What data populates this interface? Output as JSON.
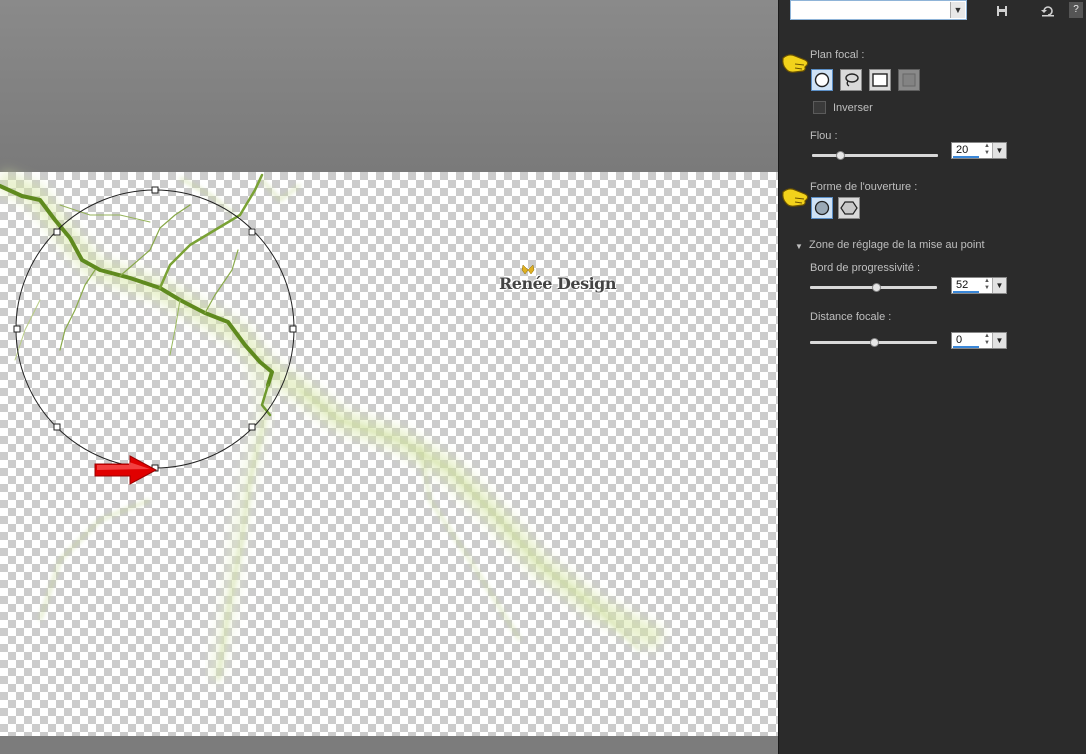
{
  "panel": {
    "preset_value": "",
    "plan_focal_label": "Plan focal :",
    "inverser_label": "Inverser",
    "flou_label": "Flou :",
    "flou_value": "20",
    "forme_label": "Forme de l'ouverture :",
    "zone_label": "Zone de réglage de la mise au point",
    "bord_label": "Bord de progressivité :",
    "bord_value": "52",
    "distance_label": "Distance focale :",
    "distance_value": "0",
    "help": "?"
  },
  "canvas": {
    "watermark": "Renée Design"
  },
  "colors": {
    "accent": "#3a87d8",
    "panel_bg": "#2b2b2b",
    "lightning": "#6b8e23",
    "arrow": "#e00000"
  },
  "icons": {
    "shapes": [
      "circle-icon",
      "lasso-icon",
      "rectangle-icon",
      "disabled-rect-icon"
    ],
    "apertures": [
      "circle-aperture-icon",
      "hexagon-aperture-icon"
    ]
  }
}
